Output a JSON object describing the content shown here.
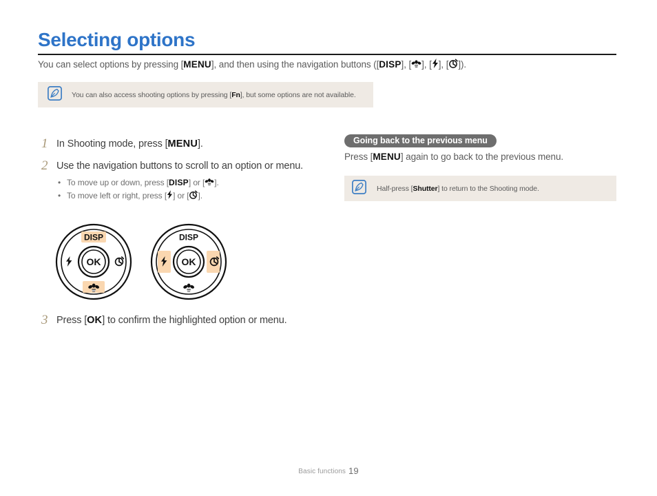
{
  "page": {
    "title": "Selecting options",
    "intro_pre": "You can select options by pressing [",
    "intro_menu": "MENU",
    "intro_mid": "], and then using the navigation buttons ([",
    "intro_disp": "DISP",
    "intro_after_disp": "], [",
    "intro_after_macro": "], [",
    "intro_after_flash": "], [",
    "intro_end": "]).",
    "title_color": "#2e74c8",
    "step_number_color": "#a89878",
    "highlight_color": "#fad7b0",
    "note_bg_color": "#efeae4",
    "pill_bg_color": "#6e6e6e"
  },
  "note_top": {
    "icon": "note-pen-icon",
    "text_pre": "You can also access shooting options by pressing [",
    "key": "Fn",
    "text_post": "], but some options are not available."
  },
  "steps": [
    {
      "number": "1",
      "text_pre": "In Shooting mode, press [",
      "key": "MENU",
      "text_post": "]."
    },
    {
      "number": "2",
      "text": "Use the navigation buttons to scroll to an option or menu.",
      "bullets": [
        {
          "pre": "To move up or down, press [",
          "key1": "DISP",
          "mid": "] or [",
          "post": "]."
        },
        {
          "pre": "To move left or right, press [",
          "mid": "] or [",
          "post": "]."
        }
      ]
    },
    {
      "number": "3",
      "text_pre": "Press [",
      "key": "OK",
      "text_post": "] to confirm the highlighted option or menu."
    }
  ],
  "wheels": [
    {
      "name": "wheel-up-down",
      "top_label": "DISP",
      "center_label": "OK",
      "top_highlighted": true,
      "bottom_highlighted": true,
      "left_highlighted": false,
      "right_highlighted": false,
      "left_icon": "flash-icon",
      "right_icon": "timer-icon",
      "bottom_icon": "macro-icon"
    },
    {
      "name": "wheel-left-right",
      "top_label": "DISP",
      "center_label": "OK",
      "top_highlighted": false,
      "bottom_highlighted": false,
      "left_highlighted": true,
      "right_highlighted": true,
      "left_icon": "flash-icon",
      "right_icon": "timer-icon",
      "bottom_icon": "macro-icon"
    }
  ],
  "right_section": {
    "heading": "Going back to the previous menu",
    "body_pre": "Press [",
    "body_key": "MENU",
    "body_post": "] again to go back to the previous menu."
  },
  "note_right": {
    "icon": "note-pen-icon",
    "text_pre": "Half-press [",
    "key": "Shutter",
    "text_post": "] to return to the Shooting mode."
  },
  "footer": {
    "section": "Basic functions",
    "page_number": "19"
  }
}
